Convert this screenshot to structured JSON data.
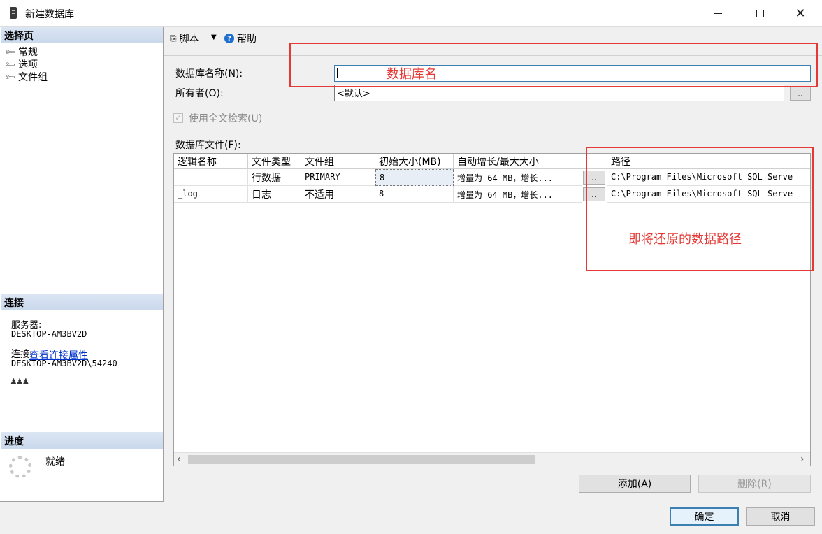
{
  "window": {
    "title": "新建数据库"
  },
  "left": {
    "select_page_header": "选择页",
    "pages": [
      {
        "label": "常规"
      },
      {
        "label": "选项"
      },
      {
        "label": "文件组"
      }
    ],
    "connection_header": "连接",
    "server_label": "服务器:",
    "server_value": "DESKTOP-AM3BV2D",
    "connection_label": "连接:",
    "connection_value": "DESKTOP-AM3BV2D\\54240",
    "view_props_link": "查看连接属性",
    "progress_header": "进度",
    "progress_status": "就绪"
  },
  "toolbar": {
    "script_label": "脚本",
    "help_label": "帮助"
  },
  "form": {
    "db_name_label": "数据库名称(N):",
    "db_name_value": "",
    "owner_label": "所有者(O):",
    "owner_value": "<默认>",
    "fulltext_label": "使用全文检索(U)",
    "files_label": "数据库文件(F):"
  },
  "grid": {
    "columns": [
      "逻辑名称",
      "文件类型",
      "文件组",
      "初始大小(MB)",
      "自动增长/最大大小",
      "",
      "路径"
    ],
    "rows": [
      {
        "logical_name": "",
        "file_type": "行数据",
        "filegroup": "PRIMARY",
        "initial_size": "8",
        "autogrowth": "增量为 64 MB，增长...",
        "browse": "..",
        "path": "C:\\Program Files\\Microsoft SQL Serve"
      },
      {
        "logical_name": "_log",
        "file_type": "日志",
        "filegroup": "不适用",
        "initial_size": "8",
        "autogrowth": "增量为 64 MB，增长...",
        "browse": "..",
        "path": "C:\\Program Files\\Microsoft SQL Serve"
      }
    ]
  },
  "buttons": {
    "add": "添加(A)",
    "remove": "删除(R)",
    "ok": "确定",
    "cancel": "取消",
    "browse": ".."
  },
  "annotations": {
    "db_name_note": "数据库名",
    "path_note": "即将还原的数据路径",
    "color": "#e53935"
  }
}
